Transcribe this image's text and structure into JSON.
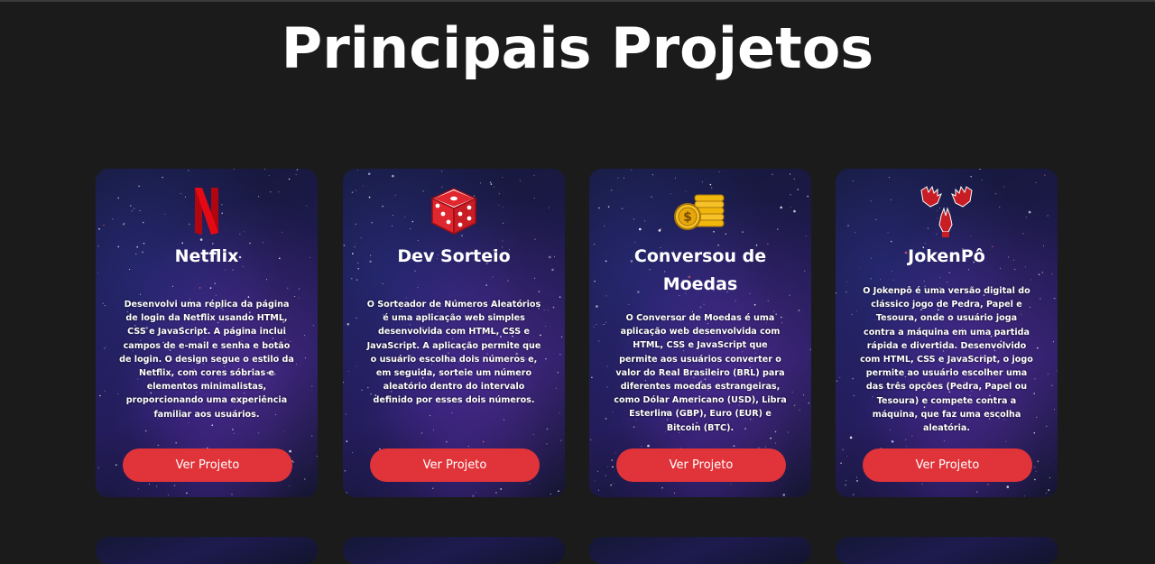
{
  "page": {
    "title": "Principais Projetos"
  },
  "colors": {
    "background": "#1b1b1c",
    "button": "#e0343a",
    "card_bg": "#1e1a4e"
  },
  "projects": [
    {
      "icon": "netflix-logo-icon",
      "title": "Netflix",
      "description": "Desenvolvi uma réplica da página de login da Netflix usando HTML, CSS e JavaScript. A página inclui campos de e-mail e senha e botão de login. O design segue o estilo da Netflix, com cores sóbrias e elementos minimalistas, proporcionando uma experiência familiar aos usuários.",
      "button_label": "Ver Projeto"
    },
    {
      "icon": "dice-icon",
      "title": "Dev Sorteio",
      "description": "O Sorteador de Números Aleatórios é uma aplicação web simples desenvolvida com HTML, CSS e JavaScript. A aplicação permite que o usuário escolha dois números e, em seguida, sorteie um número aleatório dentro do intervalo definido por esses dois números.",
      "button_label": "Ver Projeto"
    },
    {
      "icon": "coins-icon",
      "title": "Conversou de Moedas",
      "description": "O Conversor de Moedas é uma aplicação web desenvolvida com HTML, CSS e JavaScript que permite aos usuários converter o valor do Real Brasileiro (BRL) para diferentes moedas estrangeiras, como Dólar Americano (USD), Libra Esterlina (GBP), Euro (EUR) e Bitcoin (BTC).",
      "button_label": "Ver Projeto"
    },
    {
      "icon": "rock-paper-scissors-hands-icon",
      "title": "JokenPô",
      "description": "O Jokenpô é uma versão digital do clássico jogo de Pedra, Papel e Tesoura, onde o usuário joga contra a máquina em uma partida rápida e divertida. Desenvolvido com HTML, CSS e JavaScript, o jogo permite ao usuário escolher uma das três opções (Pedra, Papel ou Tesoura) e compete contra a máquina, que faz uma escolha aleatória.",
      "button_label": "Ver Projeto"
    }
  ]
}
